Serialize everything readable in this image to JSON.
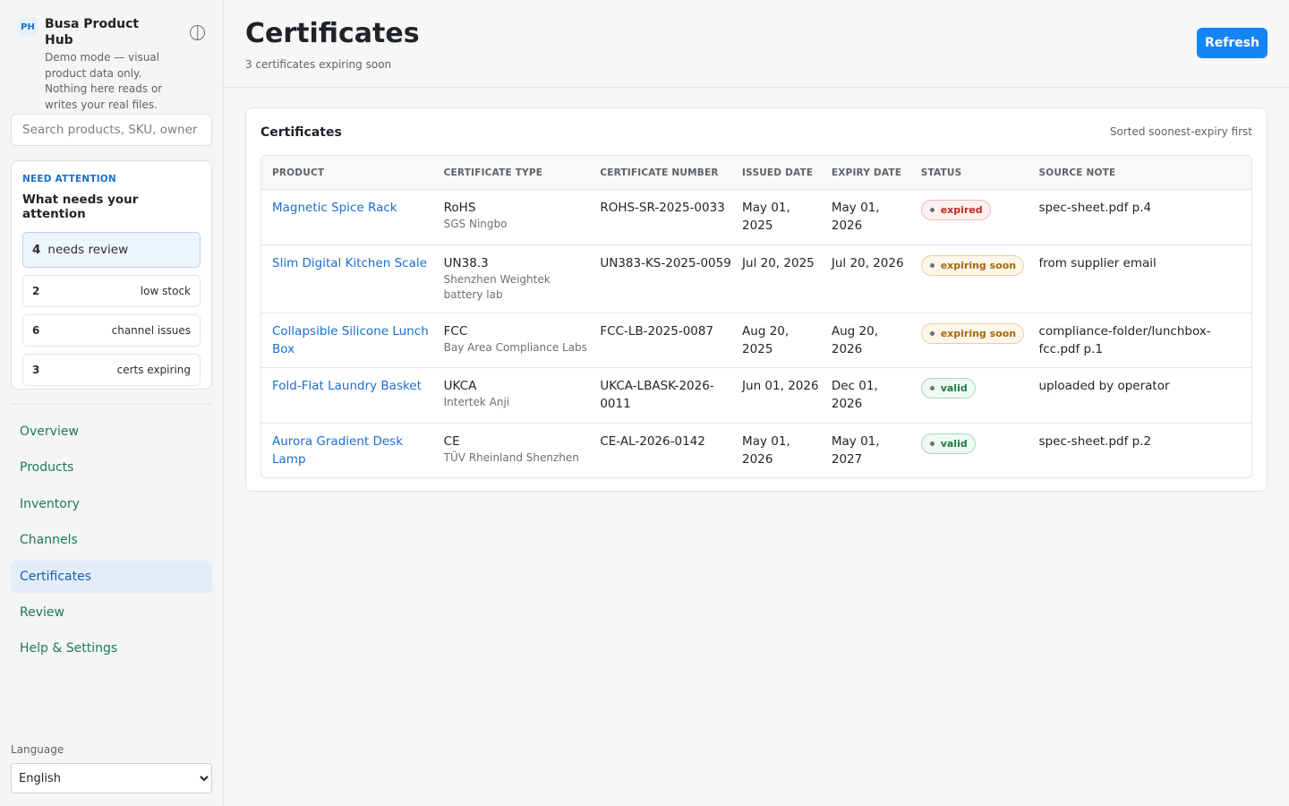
{
  "brand": {
    "logo": "PH",
    "name": "Busa Product Hub",
    "description": "Demo mode — visual product data only. Nothing here reads or writes your real files."
  },
  "search": {
    "placeholder": "Search products, SKU, owner"
  },
  "attention": {
    "kicker": "NEED ATTENTION",
    "title": "What needs your attention",
    "items": [
      {
        "count": "4",
        "label": "needs review"
      },
      {
        "count": "2",
        "label": "low stock"
      },
      {
        "count": "6",
        "label": "channel issues"
      },
      {
        "count": "3",
        "label": "certs expiring"
      }
    ]
  },
  "nav": [
    {
      "label": "Overview"
    },
    {
      "label": "Products"
    },
    {
      "label": "Inventory"
    },
    {
      "label": "Channels"
    },
    {
      "label": "Certificates",
      "active": true
    },
    {
      "label": "Review"
    },
    {
      "label": "Help & Settings"
    }
  ],
  "language": {
    "label": "Language",
    "selected": "English"
  },
  "header": {
    "title": "Certificates",
    "subtitle": "3 certificates expiring soon",
    "refresh_label": "Refresh"
  },
  "card": {
    "title": "Certificates",
    "sort_note": "Sorted soonest-expiry first",
    "columns": [
      "PRODUCT",
      "CERTIFICATE TYPE",
      "CERTIFICATE NUMBER",
      "ISSUED DATE",
      "EXPIRY DATE",
      "STATUS",
      "SOURCE NOTE"
    ],
    "rows": [
      {
        "product": "Magnetic Spice Rack",
        "type": "RoHS",
        "lab": "SGS Ningbo",
        "number": "ROHS-SR-2025-0033",
        "issued": "May 01, 2025",
        "expiry": "May 01, 2026",
        "status": "expired",
        "source": "spec-sheet.pdf p.4"
      },
      {
        "product": "Slim Digital Kitchen Scale",
        "type": "UN38.3",
        "lab": "Shenzhen Weightek battery lab",
        "number": "UN383-KS-2025-0059",
        "issued": "Jul 20, 2025",
        "expiry": "Jul 20, 2026",
        "status": "expiring soon",
        "source": "from supplier email"
      },
      {
        "product": "Collapsible Silicone Lunch Box",
        "type": "FCC",
        "lab": "Bay Area Compliance Labs",
        "number": "FCC-LB-2025-0087",
        "issued": "Aug 20, 2025",
        "expiry": "Aug 20, 2026",
        "status": "expiring soon",
        "source": "compliance-folder/lunchbox-fcc.pdf p.1"
      },
      {
        "product": "Fold-Flat Laundry Basket",
        "type": "UKCA",
        "lab": "Intertek Anji",
        "number": "UKCA-LBASK-2026-0011",
        "issued": "Jun 01, 2026",
        "expiry": "Dec 01, 2026",
        "status": "valid",
        "source": "uploaded by operator"
      },
      {
        "product": "Aurora Gradient Desk Lamp",
        "type": "CE",
        "lab": "TÜV Rheinland Shenzhen",
        "number": "CE-AL-2026-0142",
        "issued": "May 01, 2026",
        "expiry": "May 01, 2027",
        "status": "valid",
        "source": "spec-sheet.pdf p.2"
      }
    ]
  },
  "colors": {
    "accent": "#1485f4",
    "link": "#1a6fd1",
    "nav_text": "#1f7a55",
    "expired": "#c0271d",
    "expiring_soon": "#a8680a",
    "valid": "#1e7a48"
  }
}
